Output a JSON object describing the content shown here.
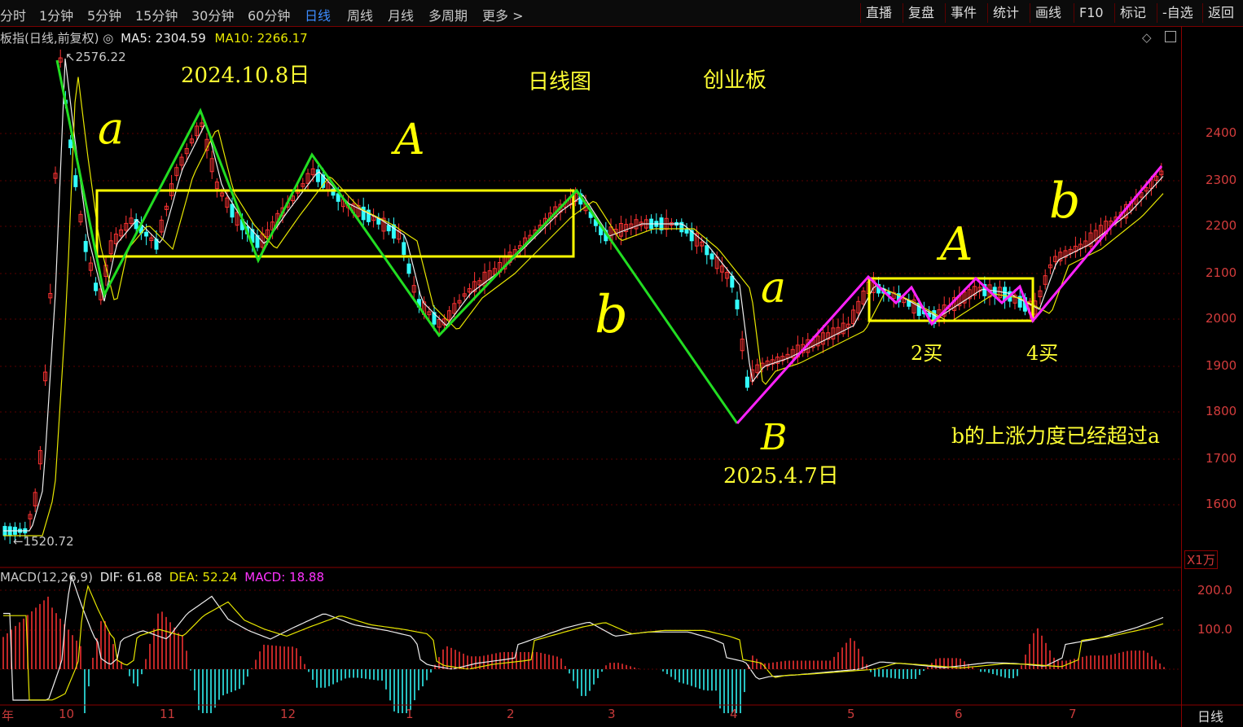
{
  "toolbar": {
    "periods": [
      "分时",
      "1分钟",
      "5分钟",
      "15分钟",
      "30分钟",
      "60分钟",
      "日线",
      "周线",
      "月线",
      "多周期",
      "更多 >"
    ],
    "active_period": "日线",
    "tools": [
      "直播",
      "复盘",
      "事件",
      "统计",
      "画线",
      "F10",
      "标记",
      "-自选",
      "返回"
    ]
  },
  "info": {
    "title": "板指(日线,前复权)",
    "ma5_label": "MA5: 2304.59",
    "ma10_label": "MA10: 2266.17"
  },
  "price_marks": {
    "high": "2576.22",
    "low": "1520.72"
  },
  "annotations": {
    "date_top": "2024.10.8日",
    "chart_type": "日线图",
    "board": "创业板",
    "date_bottom": "2025.4.7日",
    "buy2": "2买",
    "buy4": "4买",
    "conclusion": "b的上涨力度已经超过a",
    "hand_a_left": "a",
    "hand_A_left": "A",
    "hand_b_left": "b",
    "hand_a_right": "a",
    "hand_B": "B",
    "hand_A_right": "A",
    "hand_b_right": "b"
  },
  "macd": {
    "label": "MACD(12,26,9)",
    "dif": "DIF: 61.68",
    "dea": "DEA: 52.24",
    "macd": "MACD: 18.88"
  },
  "y_axis": [
    "2400",
    "2300",
    "2200",
    "2100",
    "2000",
    "1900",
    "1800",
    "1700",
    "1600"
  ],
  "macd_axis": [
    "200.0",
    "100.0"
  ],
  "unit": "X1万",
  "x_axis": [
    "年",
    "10",
    "11",
    "12",
    "1",
    "2",
    "3",
    "4",
    "5",
    "6",
    "7"
  ],
  "bottom_right": "日线",
  "colors": {
    "up": "#ff3333",
    "down": "#33ffff",
    "zigzag_left": "#22dd22",
    "zigzag_right": "#ff22ff",
    "box": "#ffff00"
  }
}
